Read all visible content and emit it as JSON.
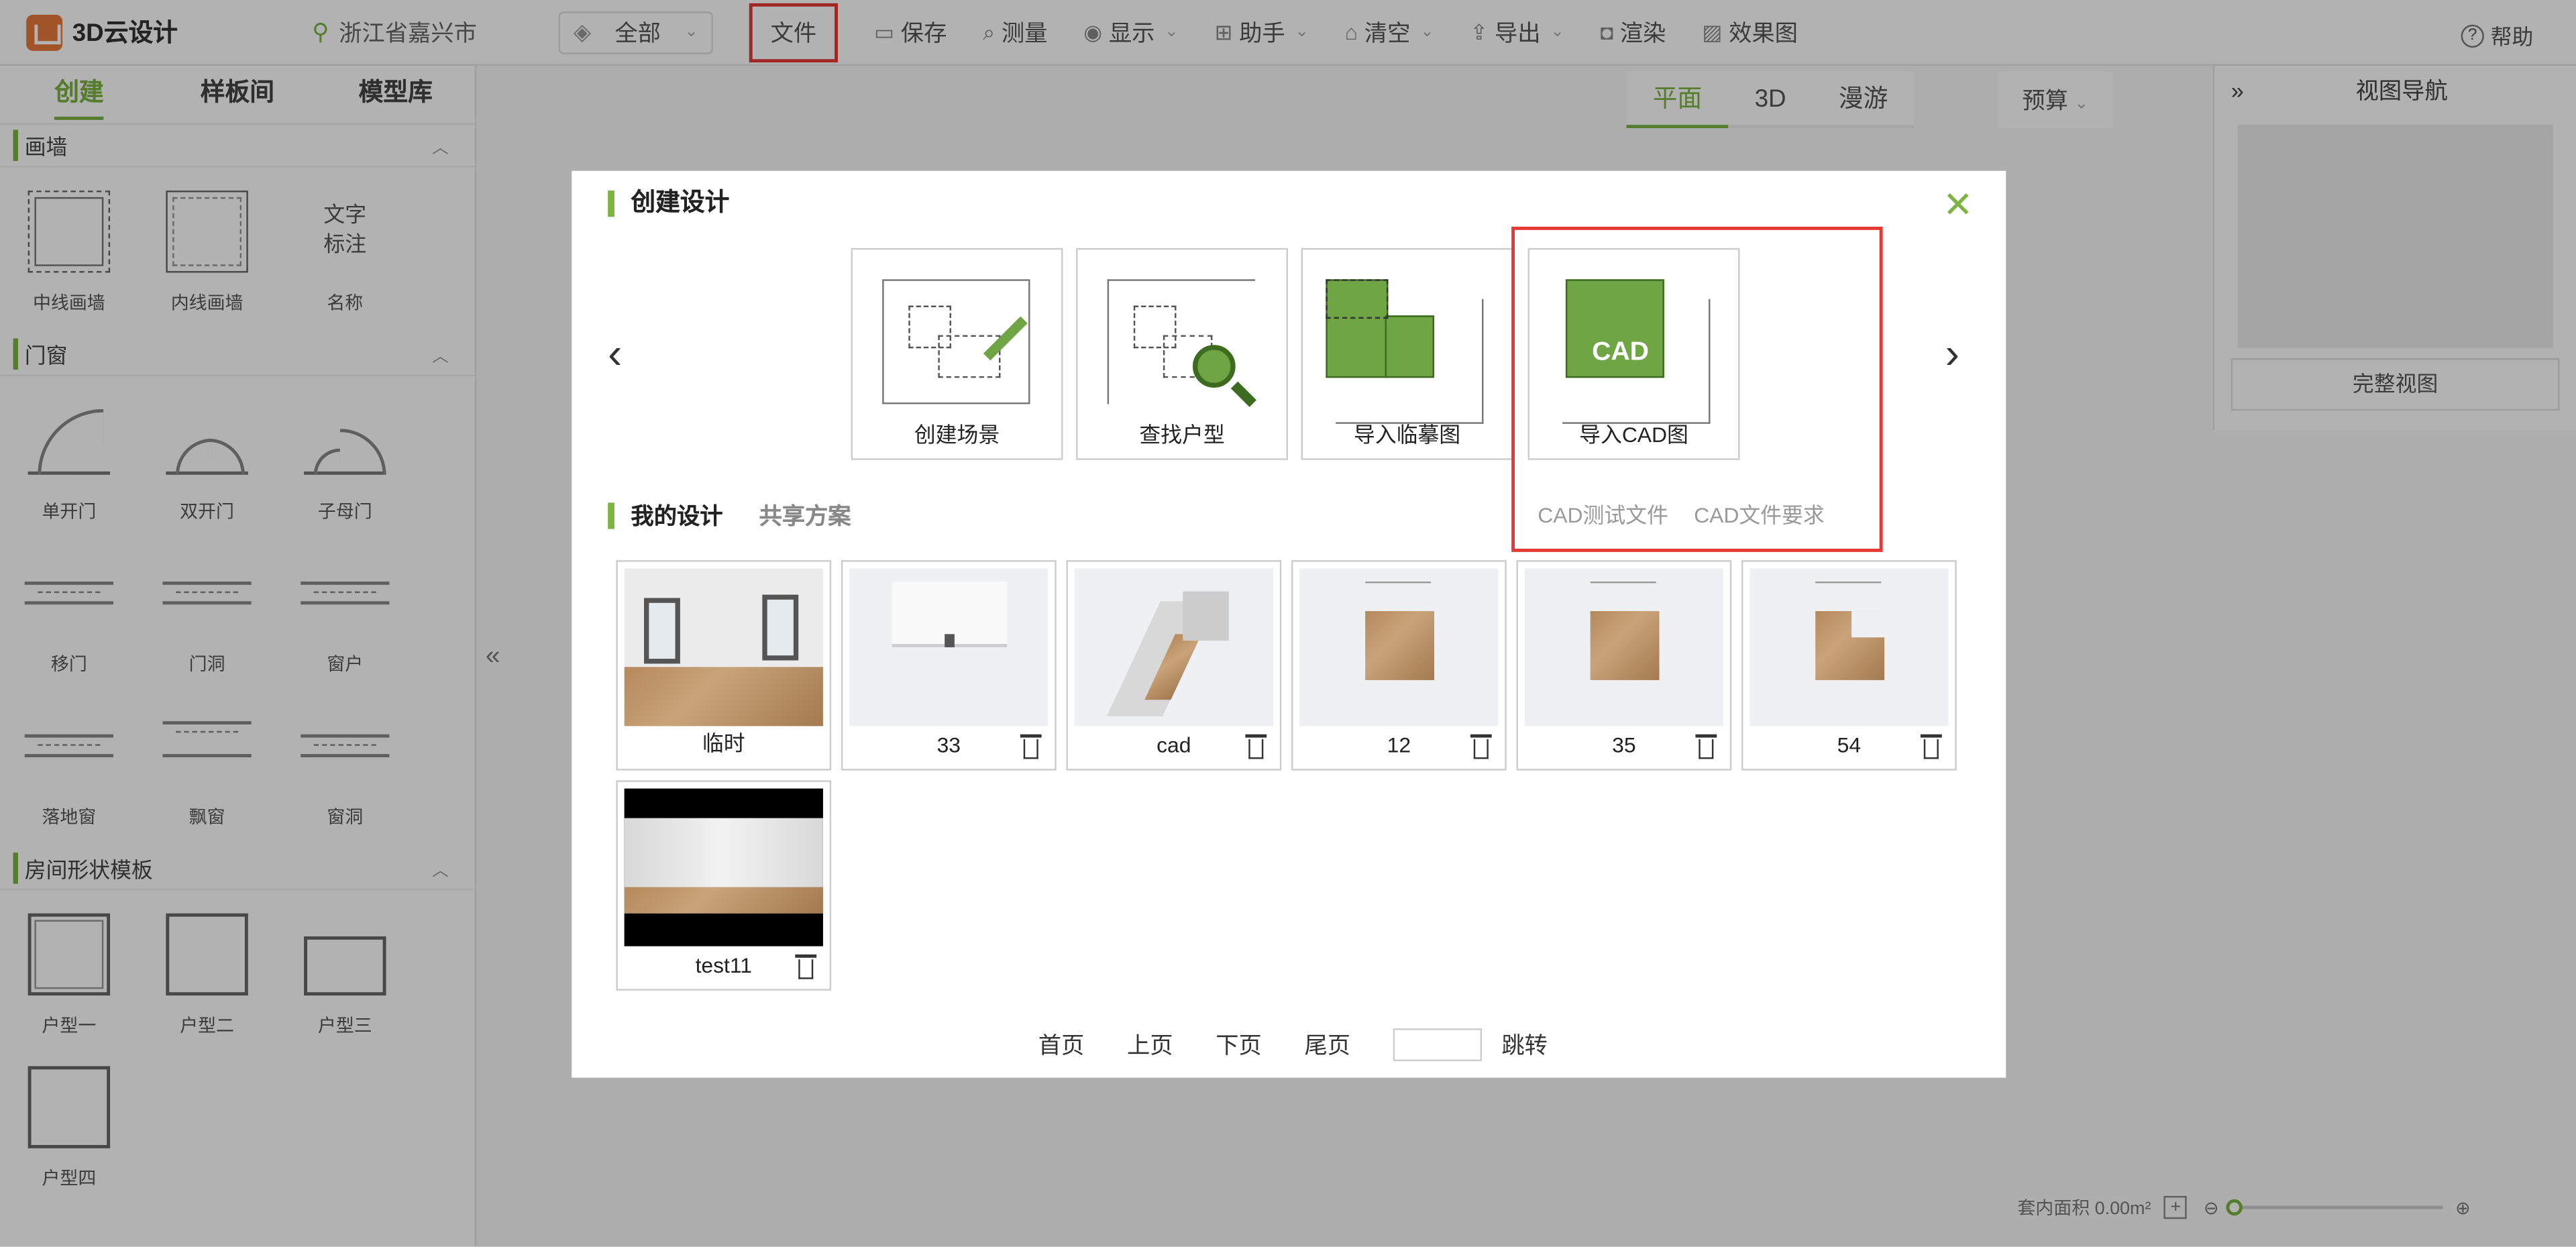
{
  "app": {
    "title": "3D云设计",
    "location": "浙江省嘉兴市",
    "scope_select": "全部"
  },
  "toolbar": {
    "file": "文件",
    "save": "保存",
    "measure": "测量",
    "display": "显示",
    "assistant": "助手",
    "clear": "清空",
    "export": "导出",
    "render": "渲染",
    "effect_image": "效果图",
    "help": "帮助"
  },
  "left_panel": {
    "tabs": [
      "创建",
      "样板间",
      "模型库"
    ],
    "sections": {
      "wall": {
        "title": "画墙",
        "items": [
          "中线画墙",
          "内线画墙",
          "名称"
        ],
        "text_tool_lines": [
          "文字",
          "标注"
        ]
      },
      "doors_windows": {
        "title": "门窗",
        "items": [
          "单开门",
          "双开门",
          "子母门",
          "移门",
          "门洞",
          "窗户",
          "落地窗",
          "飘窗",
          "窗洞"
        ]
      },
      "room_templates": {
        "title": "房间形状模板",
        "items": [
          "户型一",
          "户型二",
          "户型三",
          "户型四"
        ]
      }
    }
  },
  "view_tabs": [
    "平面",
    "3D",
    "漫游"
  ],
  "budget": "预算",
  "view_nav": {
    "title": "视图导航",
    "full_view": "完整视图"
  },
  "status": {
    "area": "套内面积 0.00m²"
  },
  "modal": {
    "title": "创建设计",
    "create_options": [
      "创建场景",
      "查找户型",
      "导入临摹图",
      "导入CAD图"
    ],
    "cad_badge": "CAD",
    "cad_links": [
      "CAD测试文件",
      "CAD文件要求"
    ],
    "section_tabs": {
      "mine": "我的设计",
      "shared": "共享方案"
    },
    "designs": [
      "临时",
      "33",
      "cad",
      "12",
      "35",
      "54",
      "test11"
    ],
    "pager": {
      "first": "首页",
      "prev": "上页",
      "next": "下页",
      "last": "尾页",
      "jump": "跳转",
      "page_input": ""
    }
  }
}
